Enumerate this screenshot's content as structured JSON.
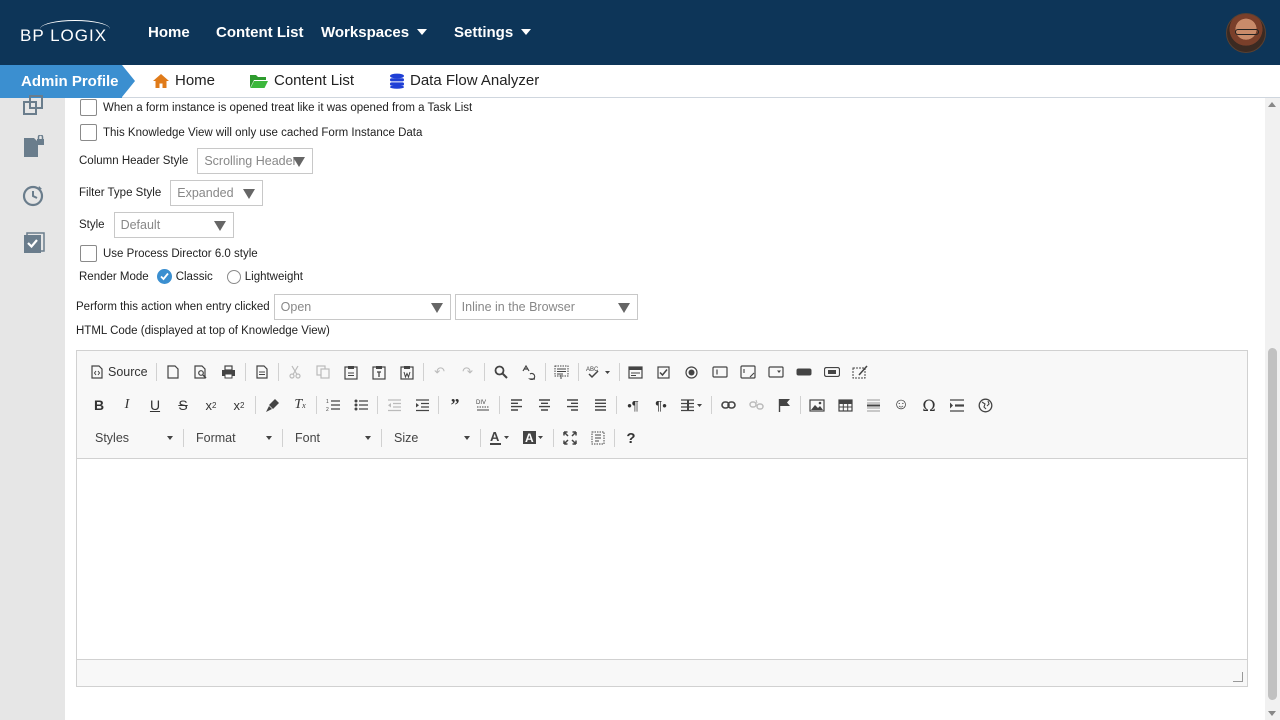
{
  "nav": {
    "logo": "BP LOGIX",
    "items": [
      {
        "label": "Home"
      },
      {
        "label": "Content List"
      },
      {
        "label": "Workspaces"
      },
      {
        "label": "Settings"
      }
    ]
  },
  "breadcrumb": {
    "active": "Admin Profile",
    "items": [
      {
        "label": "Home",
        "icon": "home-icon"
      },
      {
        "label": "Content List",
        "icon": "folder-icon"
      },
      {
        "label": "Data Flow Analyzer",
        "icon": "database-icon"
      }
    ]
  },
  "form": {
    "task_list_label": "When a form instance is opened treat like it was opened from a Task List",
    "cached_label": "This Knowledge View will only use cached Form Instance Data",
    "column_header_label": "Column Header Style",
    "column_header_value": "Scrolling Header",
    "filter_type_label": "Filter Type Style",
    "filter_type_value": "Expanded",
    "style_label": "Style",
    "style_value": "Default",
    "pd6_label": "Use Process Director 6.0 style",
    "render_mode_label": "Render Mode",
    "render_classic": "Classic",
    "render_lightweight": "Lightweight",
    "entry_action_label": "Perform this action when entry clicked",
    "entry_action_value": "Open",
    "entry_target_value": "Inline in the Browser",
    "html_code_label": "HTML Code (displayed at top of Knowledge View)"
  },
  "editor": {
    "source_label": "Source",
    "styles": "Styles",
    "format": "Format",
    "font": "Font",
    "size": "Size"
  },
  "colors": {
    "topnav": "#0d3558",
    "accent": "#3b8fd0",
    "home_icon": "#e07b1a",
    "folder_icon": "#2e9b2e",
    "db_icon": "#1f3fd6"
  }
}
